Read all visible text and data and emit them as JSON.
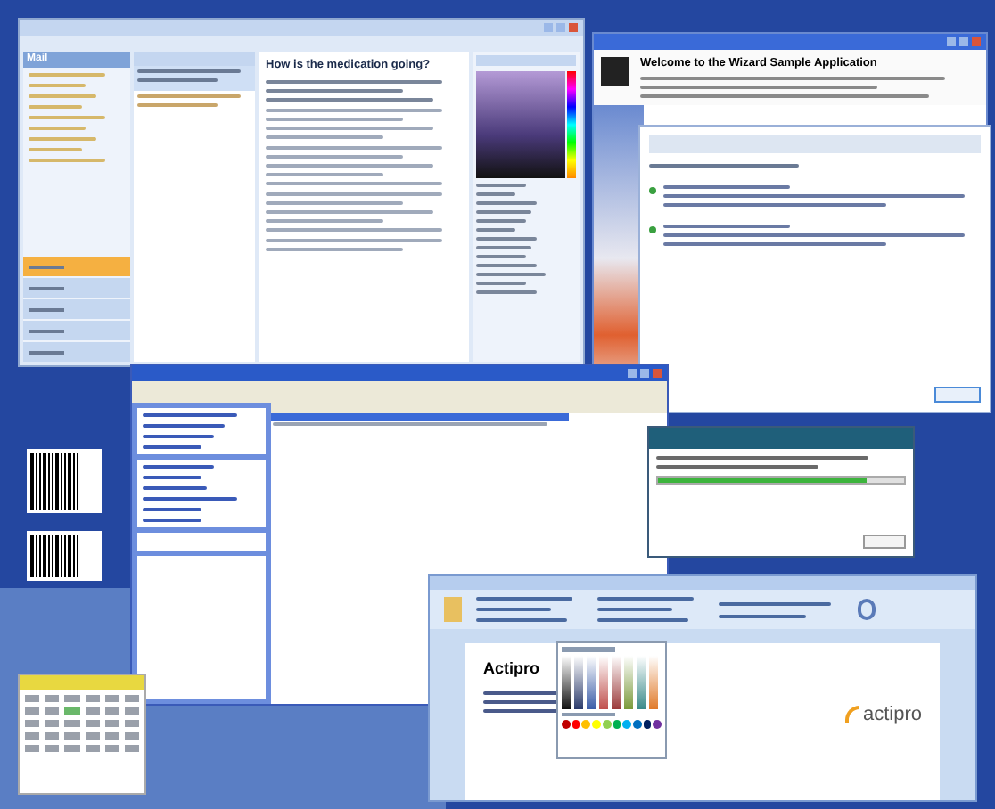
{
  "mail_window": {
    "nav_header": "Mail",
    "nav_buttons": [
      {
        "selected": true
      },
      {
        "selected": false
      },
      {
        "selected": false
      },
      {
        "selected": false
      },
      {
        "selected": false
      }
    ],
    "message_title": "How is the medication going?"
  },
  "wizard": {
    "title": "Welcome to the Wizard Sample Application"
  },
  "progress_dialog": {
    "level": 0.85
  },
  "document_window": {
    "heading": "Actipro",
    "logo": "actipro"
  }
}
